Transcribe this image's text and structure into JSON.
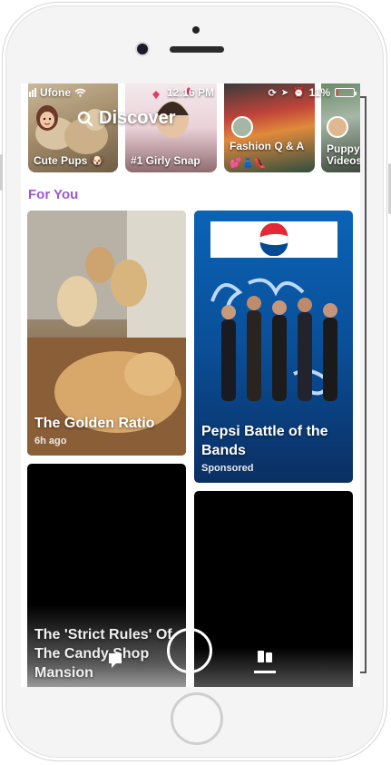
{
  "status_bar": {
    "carrier": "Ufone",
    "time": "12:16 PM",
    "battery": "11%",
    "battery_level": 0.11
  },
  "header": {
    "title": "Discover",
    "icons": [
      "search-icon",
      "bitmoji-avatar"
    ]
  },
  "top_stories": [
    {
      "label": "Cute Pups 🐶"
    },
    {
      "label": "#1 Girly Snap"
    },
    {
      "label": "Fashion Q & A"
    },
    {
      "label": "Puppy Videos"
    }
  ],
  "section": {
    "title": "For You"
  },
  "cards": [
    {
      "title": "The Golden Ratio",
      "subtitle": "6h ago"
    },
    {
      "title": "Pepsi Battle of the Bands",
      "subtitle": "Sponsored",
      "brand": "Pepsi",
      "art_text": "Battle of the Bands"
    },
    {
      "title": "The 'Strict Rules' Of The Candy Shop Mansion"
    },
    {
      "title": ""
    }
  ],
  "bottom_nav": {
    "items": [
      "chat-icon",
      "capture-button",
      "stories-icon"
    ]
  },
  "colors": {
    "accent": "#9b59d0",
    "battery_low": "#ff3b30",
    "pepsi_blue": "#0a4fa0"
  }
}
